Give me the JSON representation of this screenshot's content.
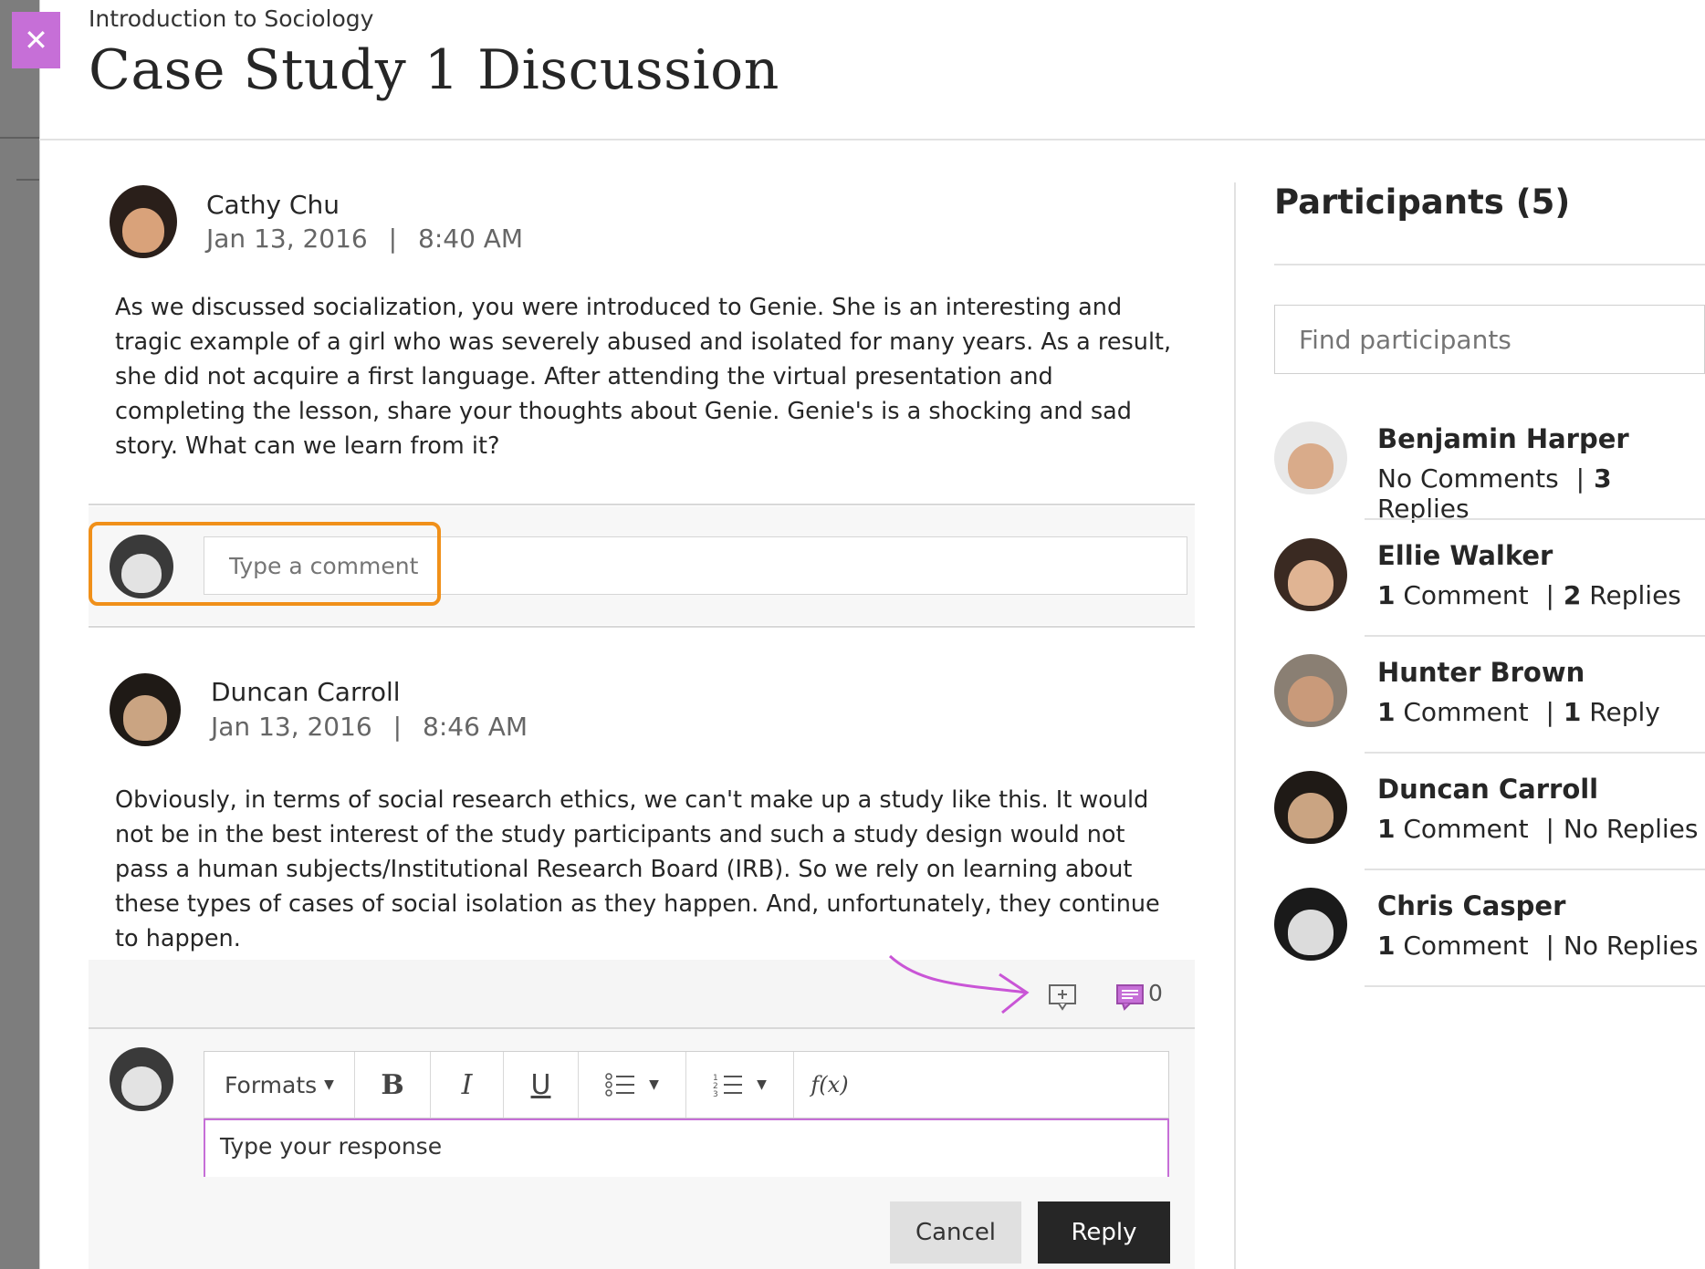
{
  "header": {
    "course": "Introduction to Sociology",
    "title": "Case Study 1 Discussion",
    "close_icon": "close-icon",
    "accent_color": "#c66fd7"
  },
  "posts": [
    {
      "author": "Cathy Chu",
      "date": "Jan 13, 2016",
      "separator": "|",
      "time": "8:40 AM",
      "body": "As we discussed socialization, you were introduced to Genie. She is an interesting and tragic example of a girl who was severely abused and isolated for many years. As a result, she did not acquire a first language. After attending the virtual presentation and completing the lesson, share your thoughts about Genie. Genie's is a shocking and sad story. What can we learn from it?"
    },
    {
      "author": "Duncan Carroll",
      "date": "Jan 13, 2016",
      "separator": "|",
      "time": "8:46 AM",
      "body": "Obviously, in terms of social research ethics, we can't make up a study like this. It would not be in the best interest of the study participants and such a study design would not pass a human subjects/Institutional Research Board (IRB). So we rely on learning about these types of cases of social isolation as they happen. And, unfortunately, they continue to happen."
    }
  ],
  "comment": {
    "placeholder": "Type a comment",
    "highlight_color": "#f0901a"
  },
  "post_actions": {
    "add_reply_icon": "add-reply-icon",
    "replies_icon": "replies-icon",
    "replies_count": "0"
  },
  "editor": {
    "formats_label": "Formats",
    "bold_label": "B",
    "italic_label": "I",
    "underline_label": "U",
    "bullet_list_icon": "bullet-list-icon",
    "numbered_list_icon": "numbered-list-icon",
    "formula_label": "f(x)",
    "response_placeholder": "Type your response",
    "cancel_label": "Cancel",
    "reply_label": "Reply"
  },
  "participants": {
    "title": "Participants (5)",
    "search_placeholder": "Find participants",
    "list": [
      {
        "name": "Benjamin Harper",
        "left": "No Comments",
        "sep": "|",
        "num": "3",
        "right": " Replies"
      },
      {
        "name": "Ellie Walker",
        "lnum": "1",
        "left": " Comment",
        "sep": "|",
        "num": "2",
        "right": " Replies"
      },
      {
        "name": "Hunter Brown",
        "lnum": "1",
        "left": " Comment",
        "sep": "|",
        "num": "1",
        "right": " Reply"
      },
      {
        "name": "Duncan Carroll",
        "lnum": "1",
        "left": " Comment",
        "sep": "|",
        "num": "",
        "right": "No Replies"
      },
      {
        "name": "Chris Casper",
        "lnum": "1",
        "left": " Comment",
        "sep": "|",
        "num": "",
        "right": "No Replies"
      }
    ]
  }
}
